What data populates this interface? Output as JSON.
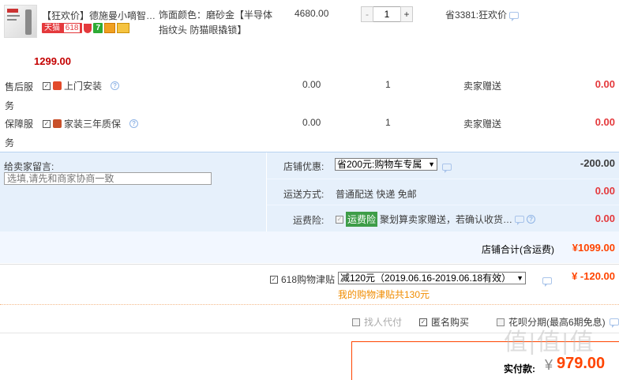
{
  "product": {
    "title": "【狂欢价】德施曼小嘀智…",
    "badge_tmall": "天猫",
    "badge_618": "618",
    "badge_7": "7",
    "attributes": "饰面颜色：磨砂金【半导体指纹头 防猫眼撬锁】",
    "unit_price": "4680.00",
    "quantity": "1",
    "minus": "-",
    "plus": "+",
    "saving": "省3381:狂欢价",
    "subtotal": "1299.00"
  },
  "services": [
    {
      "category": "售后服务",
      "name": "上门安装",
      "price": "0.00",
      "qty": "1",
      "note": "卖家赠送",
      "total": "0.00"
    },
    {
      "category": "保障服务",
      "name": "家装三年质保",
      "price": "0.00",
      "qty": "1",
      "note": "卖家赠送",
      "total": "0.00"
    }
  ],
  "seller_msg": {
    "label": "给卖家留言:",
    "placeholder": "选填,请先和商家协商一致"
  },
  "shop": {
    "discount_label": "店铺优惠:",
    "discount_select": "省200元:购物车专属",
    "discount_value": "-200.00",
    "shipping_label": "运送方式:",
    "shipping_value": "普通配送 快递 免邮",
    "shipping_cost": "0.00",
    "insurance_label": "运费险:",
    "insurance_tag": "运费险",
    "insurance_text": "聚划算卖家赠送，若确认收货…",
    "insurance_cost": "0.00",
    "total_label": "店铺合计(含运费)",
    "total_value": "¥1099.00"
  },
  "subsidy": {
    "label": "618购物津贴",
    "select": "减120元（2019.06.16-2019.06.18有效）",
    "value": "¥ -120.00",
    "mine": "我的购物津贴共130元"
  },
  "options": {
    "proxy_pay": "找人代付",
    "anonymous": "匿名购买",
    "huabei": "花呗分期(最高6期免息)"
  },
  "payment": {
    "label": "实付款:",
    "currency": "¥",
    "amount": "979.00"
  },
  "watermark": "值|值|值",
  "colors": {
    "accent_red": "#f40",
    "select_bg": "#e6f0fb",
    "highlight_green": "#3e9d48"
  }
}
